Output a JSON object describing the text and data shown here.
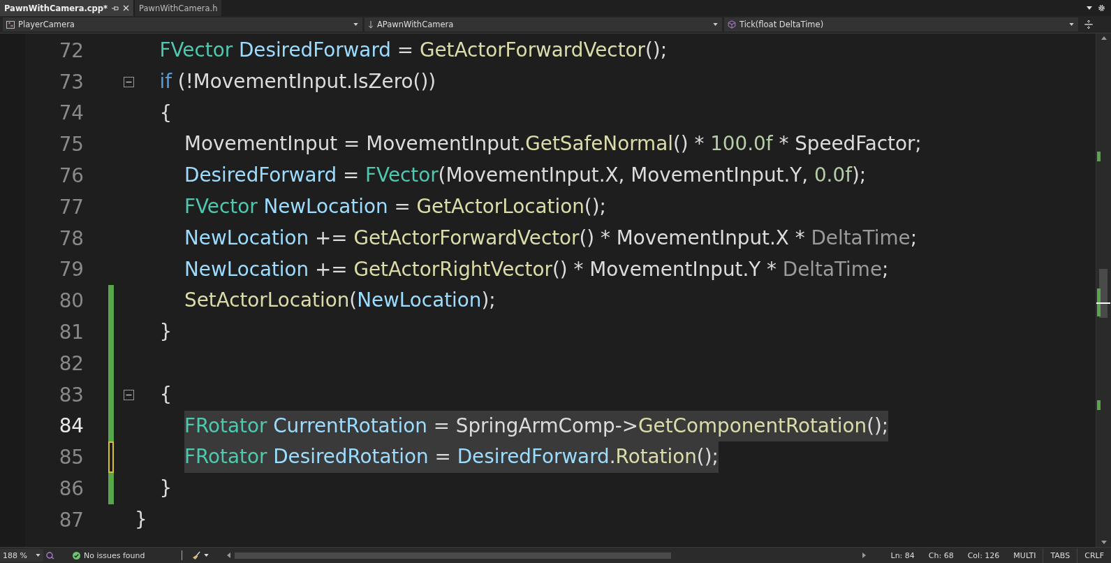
{
  "tabs": [
    {
      "label": "PawnWithCamera.cpp*",
      "selected": true
    },
    {
      "label": "PawnWithCamera.h",
      "selected": false
    }
  ],
  "nav": {
    "project": "PlayerCamera",
    "scope": "APawnWithCamera",
    "member": "Tick(float DeltaTime)"
  },
  "code": {
    "lines": [
      {
        "number": "72",
        "changed": false,
        "current": false,
        "selected": false,
        "tokens": [
          {
            "kind": "type",
            "text": "FVector "
          },
          {
            "kind": "var",
            "text": "DesiredForward"
          },
          {
            "kind": "plain",
            "text": " = "
          },
          {
            "kind": "func",
            "text": "GetActorForwardVector"
          },
          {
            "kind": "plain",
            "text": "();"
          }
        ]
      },
      {
        "number": "73",
        "changed": false,
        "expanded": true,
        "current": false,
        "selected": false,
        "tokens": [
          {
            "kind": "keyword",
            "text": "if"
          },
          {
            "kind": "plain",
            "text": " (!MovementInput.IsZero())"
          }
        ]
      },
      {
        "number": "74",
        "changed": false,
        "current": false,
        "selected": false,
        "tokens": [
          {
            "kind": "plain",
            "text": "{"
          }
        ],
        "children": [
          {
            "number": "75",
            "changed": false,
            "current": false,
            "selected": false,
            "tokens": [
              {
                "kind": "plain",
                "text": "MovementInput = MovementInput."
              },
              {
                "kind": "func",
                "text": "GetSafeNormal"
              },
              {
                "kind": "plain",
                "text": "() * "
              },
              {
                "kind": "number",
                "text": "100.0f"
              },
              {
                "kind": "plain",
                "text": " * SpeedFactor;"
              }
            ]
          },
          {
            "number": "76",
            "changed": false,
            "current": false,
            "selected": false,
            "tokens": [
              {
                "kind": "var",
                "text": "DesiredForward"
              },
              {
                "kind": "plain",
                "text": " = "
              },
              {
                "kind": "type",
                "text": "FVector"
              },
              {
                "kind": "plain",
                "text": "(MovementInput.X, MovementInput.Y, "
              },
              {
                "kind": "number",
                "text": "0.0f"
              },
              {
                "kind": "plain",
                "text": ");"
              }
            ]
          },
          {
            "number": "77",
            "changed": false,
            "current": false,
            "selected": false,
            "tokens": [
              {
                "kind": "type",
                "text": "FVector "
              },
              {
                "kind": "var",
                "text": "NewLocation"
              },
              {
                "kind": "plain",
                "text": " = "
              },
              {
                "kind": "func",
                "text": "GetActorLocation"
              },
              {
                "kind": "plain",
                "text": "();"
              }
            ]
          },
          {
            "number": "78",
            "changed": false,
            "current": false,
            "selected": false,
            "tokens": [
              {
                "kind": "var",
                "text": "NewLocation"
              },
              {
                "kind": "plain",
                "text": " += "
              },
              {
                "kind": "func",
                "text": "GetActorForwardVector"
              },
              {
                "kind": "plain",
                "text": "() * MovementInput.X * "
              },
              {
                "kind": "param",
                "text": "DeltaTime"
              },
              {
                "kind": "plain",
                "text": ";"
              }
            ]
          },
          {
            "number": "79",
            "changed": false,
            "current": false,
            "selected": false,
            "tokens": [
              {
                "kind": "var",
                "text": "NewLocation"
              },
              {
                "kind": "plain",
                "text": " += "
              },
              {
                "kind": "func",
                "text": "GetActorRightVector"
              },
              {
                "kind": "plain",
                "text": "() * MovementInput.Y * "
              },
              {
                "kind": "param",
                "text": "DeltaTime"
              },
              {
                "kind": "plain",
                "text": ";"
              }
            ]
          },
          {
            "number": "80",
            "changed": true,
            "saved": true,
            "current": false,
            "selected": false,
            "tokens": [
              {
                "kind": "func",
                "text": "SetActorLocation"
              },
              {
                "kind": "plain",
                "text": "("
              },
              {
                "kind": "var",
                "text": "NewLocation"
              },
              {
                "kind": "plain",
                "text": ");"
              }
            ]
          }
        ]
      },
      {
        "number": "81",
        "changed": true,
        "saved": true,
        "current": false,
        "selected": false,
        "tokens": [
          {
            "kind": "plain",
            "text": "}"
          }
        ]
      },
      {
        "number": "82",
        "changed": true,
        "saved": true,
        "current": false
      },
      {
        "number": "83",
        "changed": true,
        "saved": true,
        "expanded": true,
        "current": false,
        "selected": false,
        "tokens": [
          {
            "kind": "plain",
            "text": "{"
          }
        ],
        "children": [
          {
            "number": "84",
            "changed": true,
            "saved": true,
            "current": true,
            "selected": true,
            "tokens": [
              {
                "kind": "type",
                "text": "FRotator "
              },
              {
                "kind": "var",
                "text": "CurrentRotation"
              },
              {
                "kind": "plain",
                "text": " = SpringArmComp->"
              },
              {
                "kind": "func",
                "text": "GetComponentRotation"
              },
              {
                "kind": "plain",
                "text": "();"
              }
            ]
          },
          {
            "number": "85",
            "changed": true,
            "saved": false,
            "current": false,
            "selected": true,
            "tokens": [
              {
                "kind": "type",
                "text": "FRotator "
              },
              {
                "kind": "var",
                "text": "DesiredRotation"
              },
              {
                "kind": "plain",
                "text": " = "
              },
              {
                "kind": "var",
                "text": "DesiredForward"
              },
              {
                "kind": "plain",
                "text": "."
              },
              {
                "kind": "func",
                "text": "Rotation"
              },
              {
                "kind": "plain",
                "text": "();"
              }
            ]
          }
        ]
      },
      {
        "number": "86",
        "changed": true,
        "saved": true,
        "current": false,
        "selected": false,
        "tokens": [
          {
            "kind": "plain",
            "text": "}"
          }
        ]
      }
    ],
    "closing_lines": [
      {
        "number": "87",
        "changed": false,
        "current": false,
        "selected": false,
        "tokens": [
          {
            "kind": "plain",
            "text": "}"
          }
        ]
      }
    ]
  },
  "status_bar": {
    "zoom": "188 %",
    "issues": "No issues found",
    "ln": "Ln: 84",
    "ch": "Ch: 68",
    "col": "Col: 126",
    "selection_mode": "MULTI",
    "indent_mode": "TABS",
    "line_endings": "CRLF"
  }
}
